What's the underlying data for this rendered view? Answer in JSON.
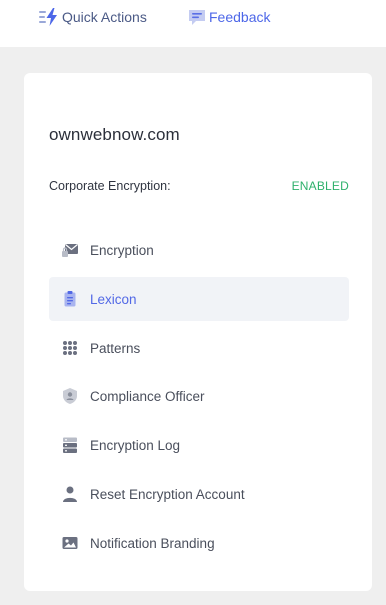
{
  "header": {
    "quick_actions": {
      "label": "Quick Actions",
      "icon": "lightning-icon"
    },
    "feedback": {
      "label": "Feedback",
      "icon": "feedback-icon"
    }
  },
  "card": {
    "domain": "ownwebnow.com",
    "encryption_label": "Corporate Encryption:",
    "encryption_status": "ENABLED",
    "menu": [
      {
        "label": "Encryption",
        "icon": "envelope-lock-icon",
        "active": false
      },
      {
        "label": "Lexicon",
        "icon": "clipboard-icon",
        "active": true
      },
      {
        "label": "Patterns",
        "icon": "grid-dots-icon",
        "active": false
      },
      {
        "label": "Compliance Officer",
        "icon": "shield-user-icon",
        "active": false
      },
      {
        "label": "Encryption Log",
        "icon": "server-log-icon",
        "active": false
      },
      {
        "label": "Reset Encryption Account",
        "icon": "user-icon",
        "active": false
      },
      {
        "label": "Notification Branding",
        "icon": "image-icon",
        "active": false
      }
    ]
  },
  "colors": {
    "accent": "#5268e6",
    "enabled": "#2eb06b",
    "background": "#efefef",
    "active_bg": "#f1f3f7"
  }
}
